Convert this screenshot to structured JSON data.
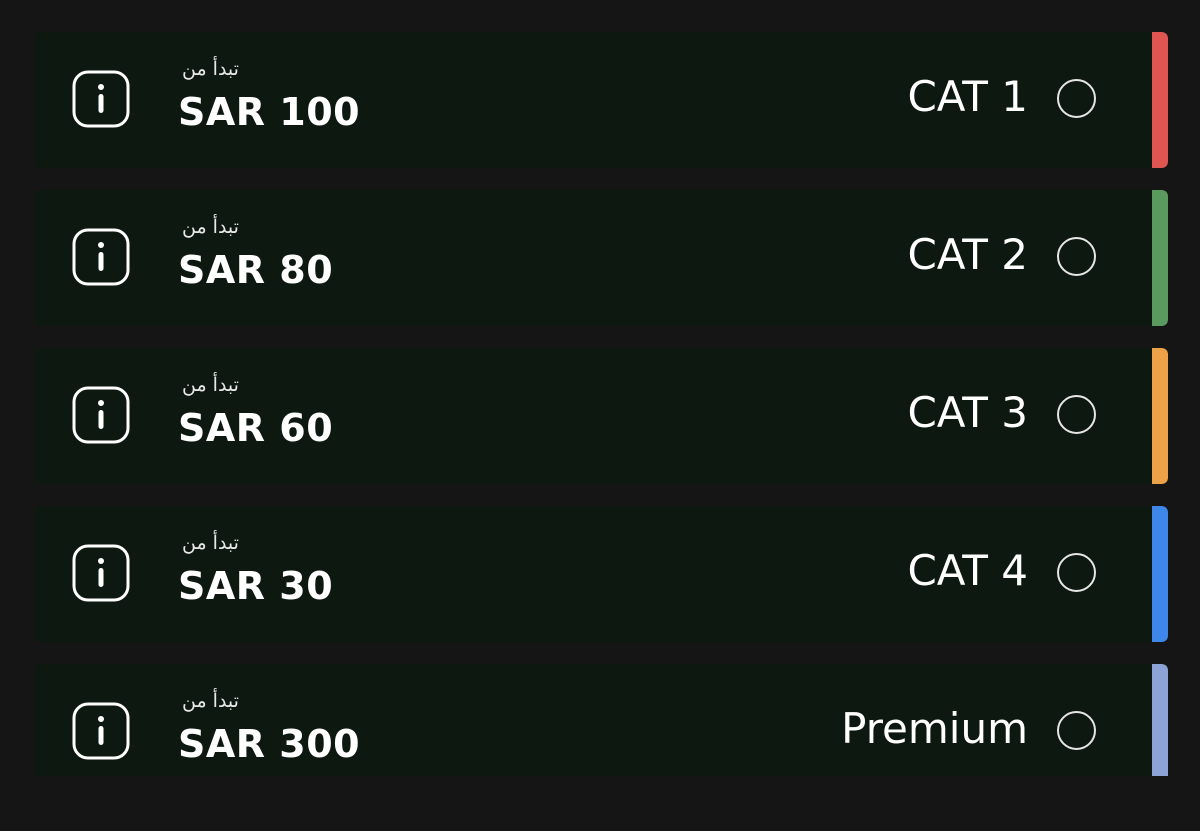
{
  "tickets": [
    {
      "from_label": "تبدأ من",
      "price": "SAR 100",
      "category": "CAT 1",
      "color": "#e05552",
      "icon": "info-icon",
      "selected": false
    },
    {
      "from_label": "تبدأ من",
      "price": "SAR 80",
      "category": "CAT 2",
      "color": "#5b9a5e",
      "icon": "info-icon",
      "selected": false
    },
    {
      "from_label": "تبدأ من",
      "price": "SAR 60",
      "category": "CAT 3",
      "color": "#eda247",
      "icon": "info-icon",
      "selected": false
    },
    {
      "from_label": "تبدأ من",
      "price": "SAR 30",
      "category": "CAT 4",
      "color": "#3f86ea",
      "icon": "info-icon",
      "selected": false
    },
    {
      "from_label": "تبدأ من",
      "price": "SAR 300",
      "category": "Premium",
      "color": "#8da2d6",
      "icon": "info-icon",
      "selected": false
    }
  ]
}
